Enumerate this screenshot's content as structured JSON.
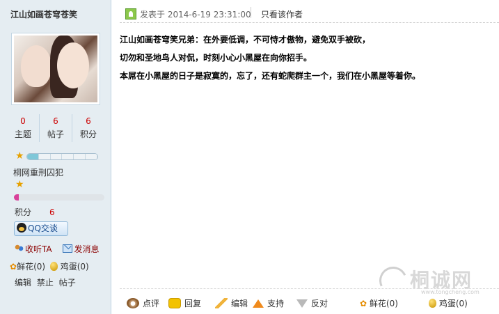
{
  "author": {
    "name": "江山如画苍穹苍笑",
    "stats": [
      {
        "value": "0",
        "label": "主题"
      },
      {
        "value": "6",
        "label": "帖子"
      },
      {
        "value": "6",
        "label": "积分"
      }
    ],
    "level_progress_segments": 6,
    "level_progress_filled": 1,
    "user_group": "桐网重刑囚犯",
    "credit_bar_fraction": 0.05,
    "credit_label": "积分",
    "credit_value": "6",
    "qq_button": "QQ交谈",
    "follow_label": "收听TA",
    "message_label": "发消息",
    "flower_label": "鲜花(0)",
    "egg_label": "鸡蛋(0)",
    "admin_links": [
      "编辑",
      "禁止",
      "帖子"
    ]
  },
  "post": {
    "posted_at": "发表于 2014-6-19 23:31:00",
    "only_author": "只看该作者",
    "lines": [
      "江山如画苍穹笑兄弟：在外要低调，不可恃才傲物，避免双手被砍，",
      "切勿和圣地鸟人对侃，时刻小心小黑屋在向你招手。",
      "本屌在小黑屋的日子是寂寞的，忘了，还有蛇爬群主一个，我们在小黑屋等着你。"
    ]
  },
  "actions": {
    "comment": "点评",
    "reply": "回复",
    "edit": "编辑",
    "support": "支持",
    "oppose": "反对",
    "flower": "鲜花(0)",
    "egg": "鸡蛋(0)"
  },
  "watermark": {
    "text": "桐诚网",
    "sub": "www.tongcheng.com"
  },
  "colors": {
    "sidebar_bg": "#e5edf2",
    "accent_red": "#cc0000",
    "credit_bar": "#d8419a"
  }
}
